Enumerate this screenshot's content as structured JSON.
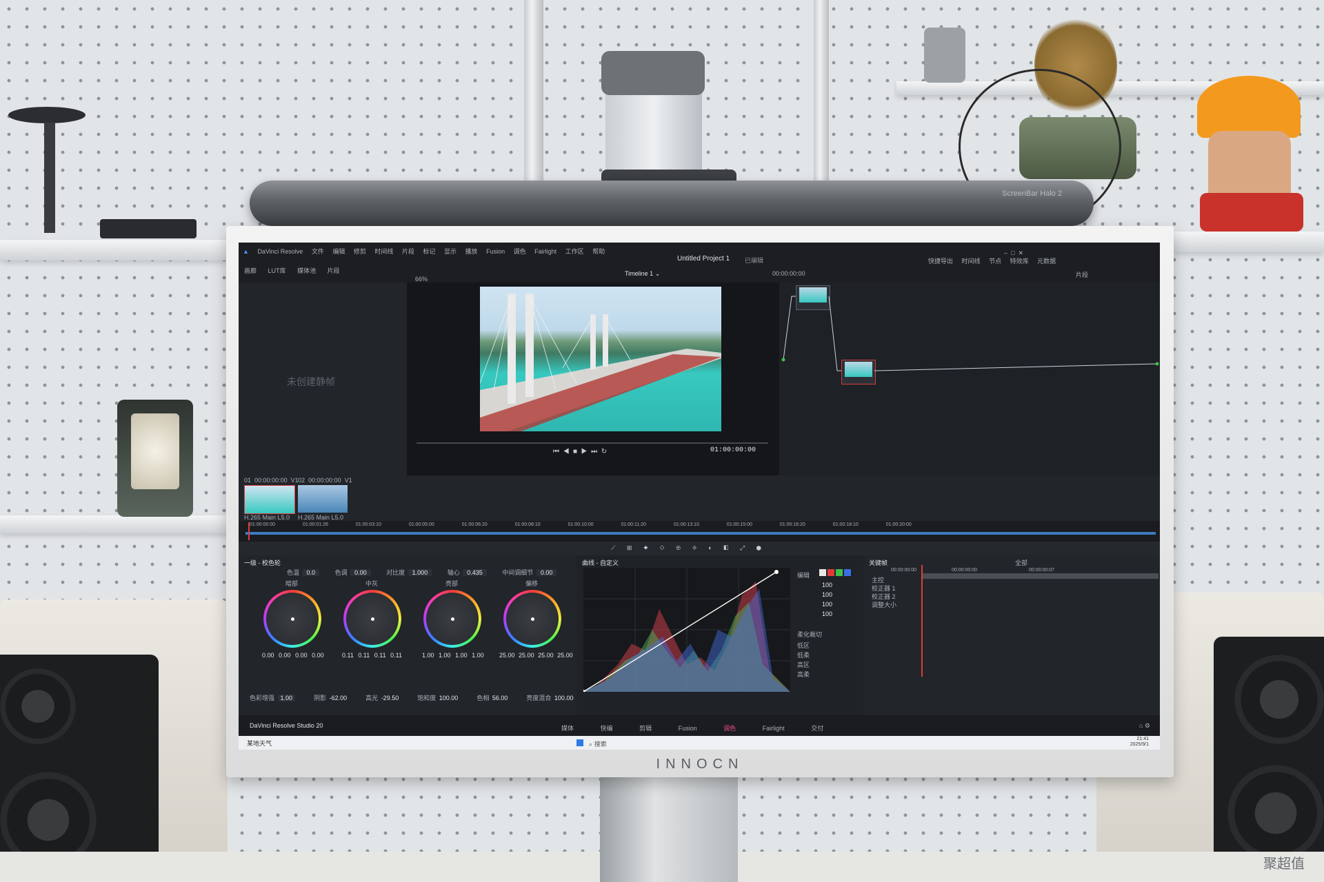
{
  "screenbar": {
    "label": "ScreenBar Halo 2"
  },
  "monitor": {
    "brand": "INNOCN"
  },
  "watermark": {
    "text": "聚超值"
  },
  "resolve": {
    "app_name": "DaVinci Resolve",
    "menu": [
      "文件",
      "编辑",
      "修剪",
      "时间线",
      "片段",
      "标记",
      "显示",
      "播放",
      "Fusion",
      "调色",
      "Fairlight",
      "工作区",
      "帮助"
    ],
    "project_title": "Untitled Project 1",
    "project_status": "已编辑",
    "toolbar_left": [
      "画廊",
      "LUT库",
      "媒体池",
      "片段"
    ],
    "toolbar_right": [
      "快捷导出",
      "时间线",
      "节点",
      "特效库",
      "元数据"
    ],
    "timeline_name": "Timeline 1",
    "zoom": "66%",
    "timecode_top": "00:00:00:00",
    "gallery_empty": "未创建静帧",
    "viewer_timecode": "01:00:00:00",
    "nodes_mode": "片段",
    "clips": [
      {
        "index": "01",
        "timecode": "00:00:00:00",
        "track": "V1",
        "codec": "H.265 Main L5.0"
      },
      {
        "index": "02",
        "timecode": "00:00:00:00",
        "track": "V1",
        "codec": "H.265 Main L5.0"
      }
    ],
    "ruler": [
      "01:00:00:00",
      "01:00:01:26",
      "01:00:03:10",
      "01:00:05:00",
      "01:00:06:20",
      "01:00:08:10",
      "01:00:10:00",
      "01:00:11:20",
      "01:00:13:10",
      "01:00:15:00",
      "01:00:16:20",
      "01:00:18:10",
      "01:00:20:00"
    ],
    "primaries": {
      "title": "一级 - 校色轮",
      "params": [
        {
          "label": "色温",
          "value": "0.0"
        },
        {
          "label": "色调",
          "value": "0.00"
        },
        {
          "label": "对比度",
          "value": "1.000"
        },
        {
          "label": "轴心",
          "value": "0.435"
        },
        {
          "label": "中间调细节",
          "value": "0.00"
        }
      ],
      "wheels": [
        {
          "name": "暗部",
          "values": [
            "0.00",
            "0.00",
            "0.00",
            "0.00"
          ]
        },
        {
          "name": "中灰",
          "values": [
            "0.11",
            "0.11",
            "0.11",
            "0.11"
          ]
        },
        {
          "name": "亮部",
          "values": [
            "1.00",
            "1.00",
            "1.00",
            "1.00"
          ]
        },
        {
          "name": "偏移",
          "values": [
            "25.00",
            "25.00",
            "25.00",
            "25.00"
          ]
        }
      ],
      "bottom_params": [
        {
          "label": "色彩增强",
          "value": "1.00"
        },
        {
          "label": "阴影",
          "value": "-62.00"
        },
        {
          "label": "高光",
          "value": "-29.50"
        },
        {
          "label": "饱和度",
          "value": "100.00"
        },
        {
          "label": "色相",
          "value": "56.00"
        },
        {
          "label": "亮度混合",
          "value": "100.00"
        }
      ]
    },
    "curves": {
      "title": "曲线 - 自定义"
    },
    "curve_side": {
      "label": "编辑",
      "values": [
        "100",
        "100",
        "100",
        "100"
      ],
      "soft_label": "柔化裁切",
      "soft_rows": [
        "低区",
        "低柔",
        "高区",
        "高柔"
      ]
    },
    "keyframes": {
      "title": "关键帧",
      "mode": "全部",
      "timecode_a": "00:00:00:00",
      "timecode_b": "00:00:00:00",
      "timecode_c": "00:00:00:07",
      "rows": [
        "主控",
        "校正器 1",
        "校正器 2",
        "调整大小"
      ]
    },
    "bottom": {
      "app_version": "DaVinci Resolve Studio 20",
      "pages": [
        "媒体",
        "快编",
        "剪辑",
        "Fusion",
        "调色",
        "Fairlight",
        "交付"
      ]
    },
    "taskbar": {
      "weather": "某地天气",
      "search": "搜索",
      "clock_time": "21:41",
      "clock_date": "2025/9/1"
    }
  }
}
